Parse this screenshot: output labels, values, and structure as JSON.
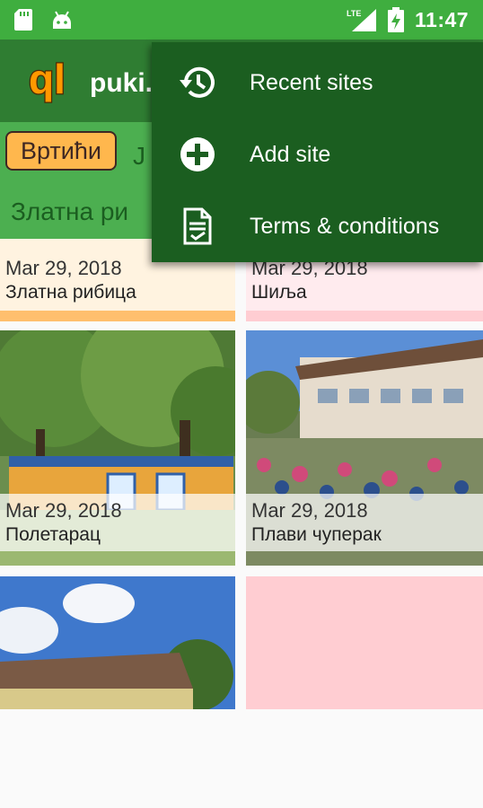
{
  "status_bar": {
    "time": "11:47",
    "network": "LTE"
  },
  "app_bar": {
    "logo_text": "ql",
    "brand": "puki."
  },
  "filters": {
    "active_chip": "Вртићи",
    "next_chip": "J",
    "subtitle": "Златна ри"
  },
  "cards": [
    {
      "date": "Mar 29, 2018",
      "name": "Златна рибица"
    },
    {
      "date": "Mar 29, 2018",
      "name": "Шиља"
    },
    {
      "date": "Mar 29, 2018",
      "name": "Полетарац"
    },
    {
      "date": "Mar 29, 2018",
      "name": "Плави чуперак"
    }
  ],
  "overflow_menu": {
    "items": [
      {
        "label": "Recent sites",
        "icon": "history-icon"
      },
      {
        "label": "Add site",
        "icon": "add-circle-icon"
      },
      {
        "label": "Terms & conditions",
        "icon": "document-icon"
      }
    ]
  },
  "colors": {
    "status_bar": "#3fae3f",
    "app_bar": "#2f7d32",
    "filter_bar": "#4caf50",
    "menu": "#1b5e20",
    "chip": "#ffb74d",
    "card_peach": "#ffe0b2",
    "card_pink": "#ffcdd2"
  }
}
